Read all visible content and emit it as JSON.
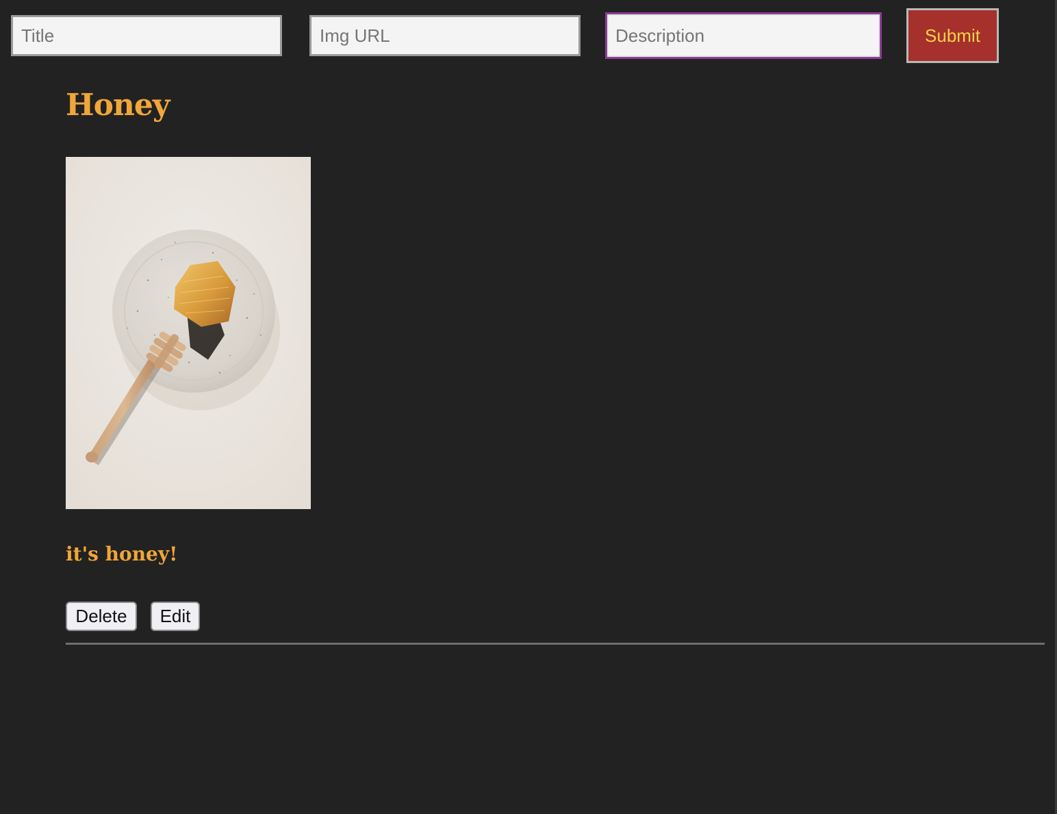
{
  "form": {
    "title_placeholder": "Title",
    "img_url_placeholder": "Img URL",
    "description_placeholder": "Description",
    "submit_label": "Submit"
  },
  "post": {
    "title": "Honey",
    "image_alt": "honeycomb on a speckled ceramic plate with a wooden honey dipper",
    "description": "it's honey!",
    "delete_label": "Delete",
    "edit_label": "Edit"
  },
  "colors": {
    "background": "#222222",
    "accent": "#f0a63a",
    "submit_bg": "#a5302c",
    "submit_text": "#f5d24a",
    "focus_border": "#8b3f96"
  }
}
